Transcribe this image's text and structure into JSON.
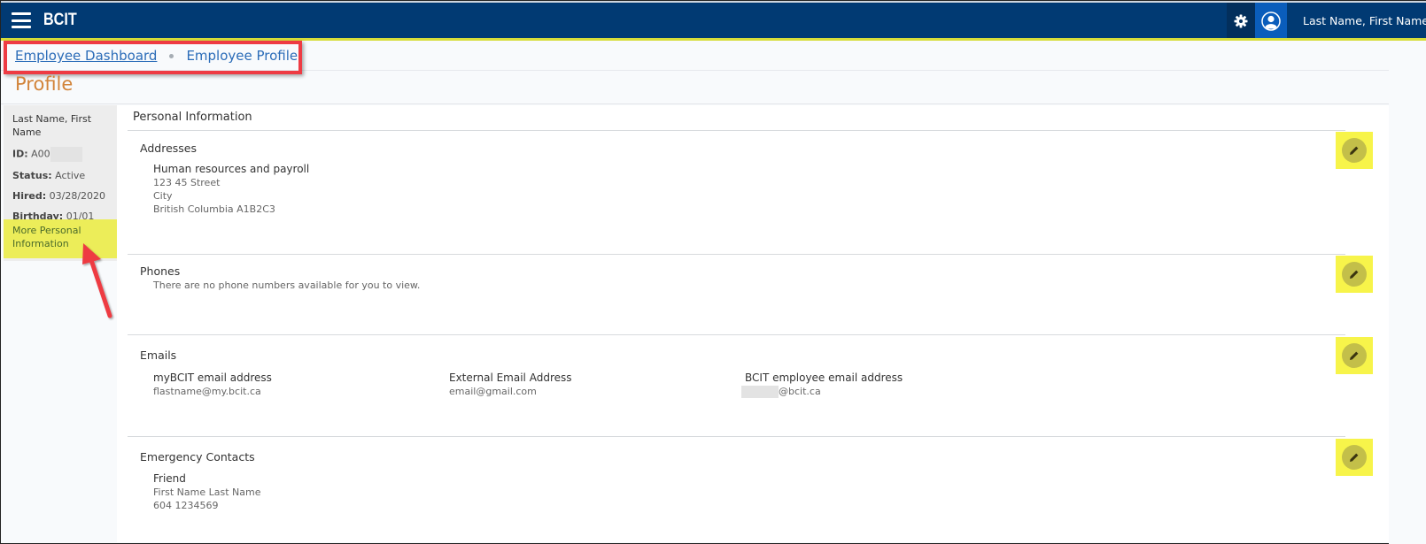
{
  "header": {
    "brand": "BCIT",
    "user_name": "Last Name, First Name",
    "icons": {
      "menu": "hamburger-icon",
      "settings": "gear-icon",
      "user": "user-avatar-icon"
    }
  },
  "breadcrumb": {
    "items": [
      {
        "label": "Employee Dashboard",
        "link": true
      },
      {
        "label": "Employee Profile",
        "link": false
      }
    ]
  },
  "page": {
    "title": "Profile"
  },
  "sidebar": {
    "name": "Last Name, First Name",
    "id_label": "ID:",
    "id_value": "A00",
    "status_label": "Status:",
    "status_value": "Active",
    "hired_label": "Hired:",
    "hired_value": "03/28/2020",
    "birthday_label": "Birthday:",
    "birthday_value": "01/01",
    "more_link": "More Personal Information"
  },
  "main": {
    "section_title": "Personal Information",
    "addresses": {
      "title": "Addresses",
      "entries": [
        {
          "type": "Human resources and payroll",
          "lines": [
            "123 45 Street",
            "City",
            "British Columbia A1B2C3"
          ]
        }
      ]
    },
    "phones": {
      "title": "Phones",
      "empty_message": "There are no phone numbers available for you to view."
    },
    "emails": {
      "title": "Emails",
      "entries": [
        {
          "label": "myBCIT email address",
          "value": "flastname@my.bcit.ca"
        },
        {
          "label": "External Email Address",
          "value": "email@gmail.com"
        },
        {
          "label": "BCIT employee email address",
          "value": "@bcit.ca"
        }
      ]
    },
    "emergency_contacts": {
      "title": "Emergency Contacts",
      "entries": [
        {
          "relationship": "Friend",
          "name": "First Name Last Name",
          "phone": "604 1234569"
        }
      ]
    },
    "edit_icon": "pencil-icon"
  },
  "annotations": {
    "highlight_color": "#f7f44a",
    "callout_color": "#ee3b43"
  }
}
